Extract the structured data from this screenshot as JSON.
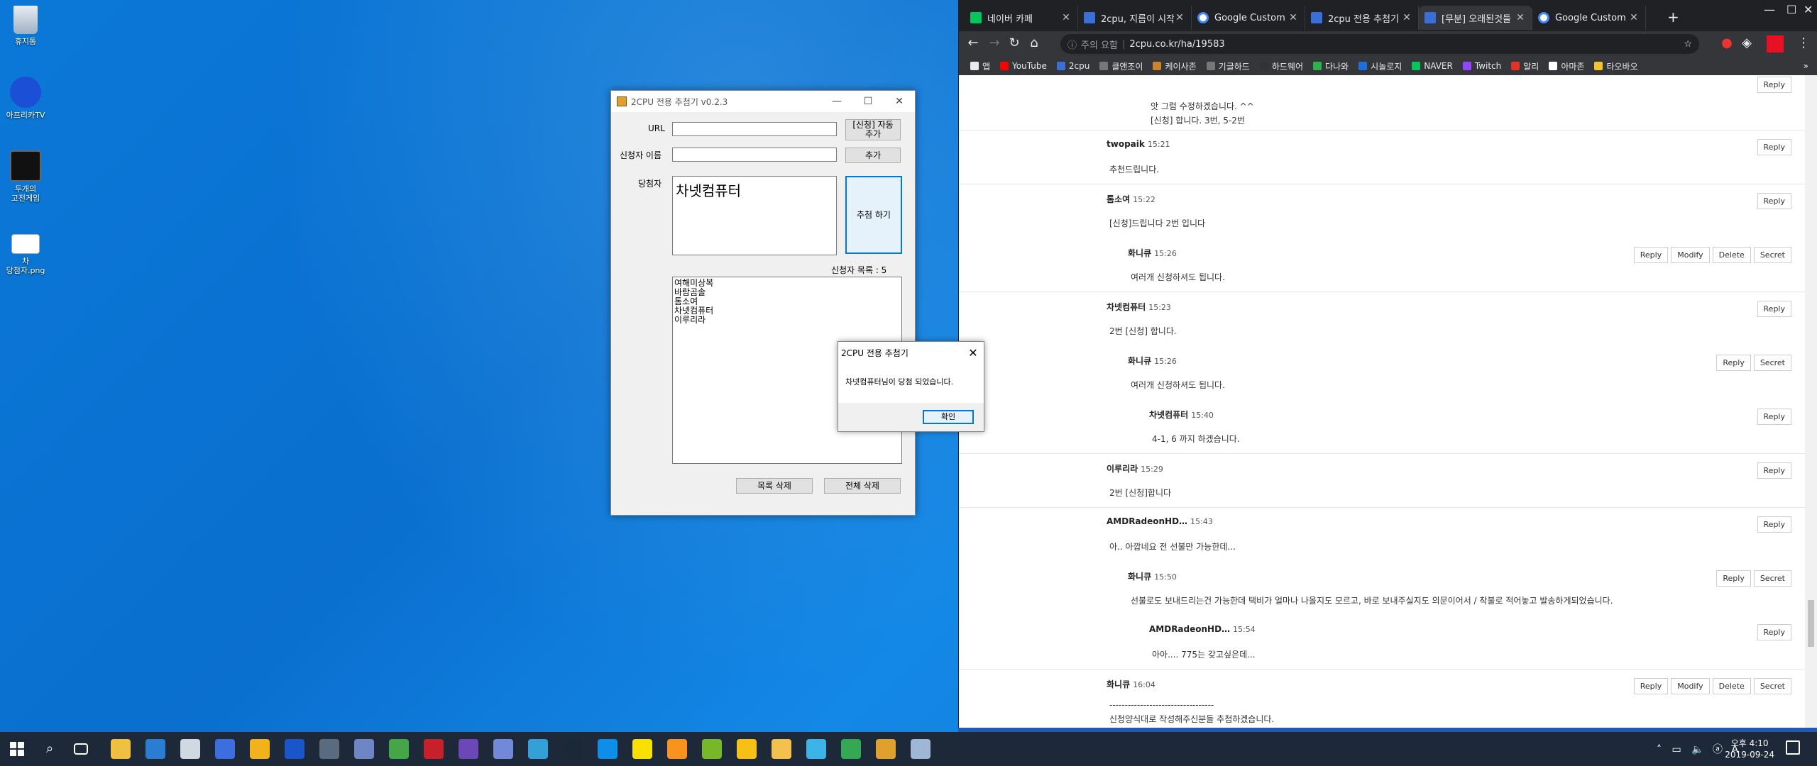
{
  "desktop": {
    "icons": [
      {
        "label": "휴지통"
      },
      {
        "label": "아프리카TV"
      },
      {
        "label": "두개의\n고전게임"
      },
      {
        "label": "차\n당첨자.png"
      }
    ]
  },
  "browser": {
    "tabs": [
      {
        "title": "네이버 카페",
        "icon": "naver-cafe-icon",
        "color": "#03c75a"
      },
      {
        "title": "2cpu, 지름이 시작",
        "icon": "2cpu-icon",
        "color": "#3a6fd8"
      },
      {
        "title": "Google Custom S",
        "icon": "google-icon",
        "color": "#ffffff"
      },
      {
        "title": "2cpu 전용 추첨기",
        "icon": "2cpu-icon",
        "color": "#3a6fd8"
      },
      {
        "title": "[무분] 오래된것들",
        "icon": "2cpu-icon",
        "color": "#3a6fd8"
      },
      {
        "title": "Google Custom S",
        "icon": "google-icon",
        "color": "#ffffff"
      }
    ],
    "address": {
      "warning": "주의 요함",
      "url": "2cpu.co.kr/ha/19583"
    },
    "bookmarks": [
      {
        "label": "앱",
        "color": "#e8eaed"
      },
      {
        "label": "YouTube",
        "color": "#ff0000"
      },
      {
        "label": "2cpu",
        "color": "#3a6fd8"
      },
      {
        "label": "클앤조이",
        "color": "#777777"
      },
      {
        "label": "케이사존",
        "color": "#c8842c"
      },
      {
        "label": "기글하드",
        "color": "#777777"
      },
      {
        "label": "하드웨어",
        "color": "#333333"
      },
      {
        "label": "다나와",
        "color": "#2bb24c"
      },
      {
        "label": "시놀로지",
        "color": "#1e6fd9"
      },
      {
        "label": "NAVER",
        "color": "#03c75a"
      },
      {
        "label": "Twitch",
        "color": "#9146ff"
      },
      {
        "label": "알리",
        "color": "#e43225"
      },
      {
        "label": "아마존",
        "color": "#ffffff"
      },
      {
        "label": "타오바오",
        "color": "#f4c430"
      }
    ],
    "comments": [
      {
        "author": "",
        "time": "",
        "body": "앗 그럼 수정하겠습니다. ^^\n[신청] 합니다. 3번, 5-2번",
        "actions": [
          "Reply"
        ]
      },
      {
        "author": "twopaik",
        "time": "15:21",
        "body": "추천드립니다.",
        "actions": [
          "Reply"
        ]
      },
      {
        "author": "톰소여",
        "time": "15:22",
        "body": "[신청]드립니다 2번 입니다",
        "actions": [
          "Reply"
        ]
      },
      {
        "author": "화니큐",
        "time": "15:26",
        "body": "여러개 신청하셔도 됩니다.",
        "actions": [
          "Reply",
          "Modify",
          "Delete",
          "Secret"
        ]
      },
      {
        "author": "차넷컴퓨터",
        "time": "15:23",
        "body": "2번 [신청] 합니다.",
        "actions": [
          "Reply"
        ]
      },
      {
        "author": "화니큐",
        "time": "15:26",
        "body": "여러개 신청하셔도 됩니다.",
        "actions": [
          "Reply",
          "Secret"
        ]
      },
      {
        "author": "차넷컴퓨터",
        "time": "15:40",
        "body": "4-1, 6 까지 하겠습니다.",
        "actions": [
          "Reply"
        ]
      },
      {
        "author": "이루리라",
        "time": "15:29",
        "body": "2번 [신청]합니다",
        "actions": [
          "Reply"
        ]
      },
      {
        "author": "AMDRadeonHD…",
        "time": "15:43",
        "body": "아.. 아깝네요 전 선불만 가능한데...",
        "actions": [
          "Reply"
        ]
      },
      {
        "author": "화니큐",
        "time": "15:50",
        "body": "선불로도 보내드리는건 가능한데 택비가 얼마나 나올지도 모르고, 바로 보내주실지도 의문이어서 / 착불로 적어놓고 발송하게되었습니다.",
        "actions": [
          "Reply",
          "Secret"
        ]
      },
      {
        "author": "AMDRadeonHD…",
        "time": "15:54",
        "body": "아아.... 775는 갖고싶은데...",
        "actions": [
          "Reply"
        ]
      },
      {
        "author": "화니큐",
        "time": "16:04",
        "body": "----------------------------------\n신청양식대로 작성해주신분들 추첨하겠습니다.",
        "actions": [
          "Reply",
          "Modify",
          "Delete",
          "Secret"
        ]
      }
    ]
  },
  "app": {
    "title": "2CPU 전용 추첨기 v0.2.3",
    "url_label": "URL",
    "url_value": "",
    "auto_add_label": "[신청] 자동\n추가",
    "name_label": "신청자 이름",
    "name_value": "",
    "add_label": "추가",
    "winner_label": "당첨자",
    "winner_value": "차넷컴퓨터",
    "draw_label": "추첨 하기",
    "count_label": "신청자 목록 : 5",
    "applicants": [
      "여해미상복",
      "바람곰솔",
      "톰소여",
      "차넷컴퓨터",
      "이루리라"
    ],
    "delete_list_label": "목록 삭제",
    "delete_all_label": "전체 삭제"
  },
  "msgbox": {
    "title": "2CPU 전용 추첨기",
    "text": "차넷컴퓨터님이 당첨 되었습니다.",
    "ok": "확인"
  },
  "taskbar": {
    "apps": [
      {
        "name": "explorer-icon",
        "color": "#f0c040"
      },
      {
        "name": "store-icon",
        "color": "#2b7cd3"
      },
      {
        "name": "mail-icon",
        "color": "#cfd8e3"
      },
      {
        "name": "u-app-icon",
        "color": "#3d6ee0"
      },
      {
        "name": "puzzle-icon",
        "color": "#f2b21b"
      },
      {
        "name": "m-app-icon",
        "color": "#1a55c9"
      },
      {
        "name": "calc-icon",
        "color": "#5a6b80"
      },
      {
        "name": "photos-icon",
        "color": "#6e86c6"
      },
      {
        "name": "map-icon",
        "color": "#44a648"
      },
      {
        "name": "flash-icon",
        "color": "#c8202a"
      },
      {
        "name": "purple-app-icon",
        "color": "#6b47b8"
      },
      {
        "name": "discord-icon",
        "color": "#7289da"
      },
      {
        "name": "bird-icon",
        "color": "#34a0d8"
      },
      {
        "name": "steam-icon",
        "color": "#1b2838"
      },
      {
        "name": "teamviewer-icon",
        "color": "#0e8ee9"
      },
      {
        "name": "kakaotalk-icon",
        "color": "#f9e000"
      },
      {
        "name": "chat-icon",
        "color": "#f7931e"
      },
      {
        "name": "torrent-icon",
        "color": "#77b82a"
      },
      {
        "name": "player-icon",
        "color": "#f6c016"
      },
      {
        "name": "folder-icon",
        "color": "#f2c14e"
      },
      {
        "name": "ie-icon",
        "color": "#3cb4e7"
      },
      {
        "name": "chrome-icon",
        "color": "#34a853"
      },
      {
        "name": "app-window-icon",
        "color": "#e0a030"
      },
      {
        "name": "feather-icon",
        "color": "#9fb6d4"
      }
    ],
    "time": "오후 4:10",
    "date": "2019-09-24"
  }
}
